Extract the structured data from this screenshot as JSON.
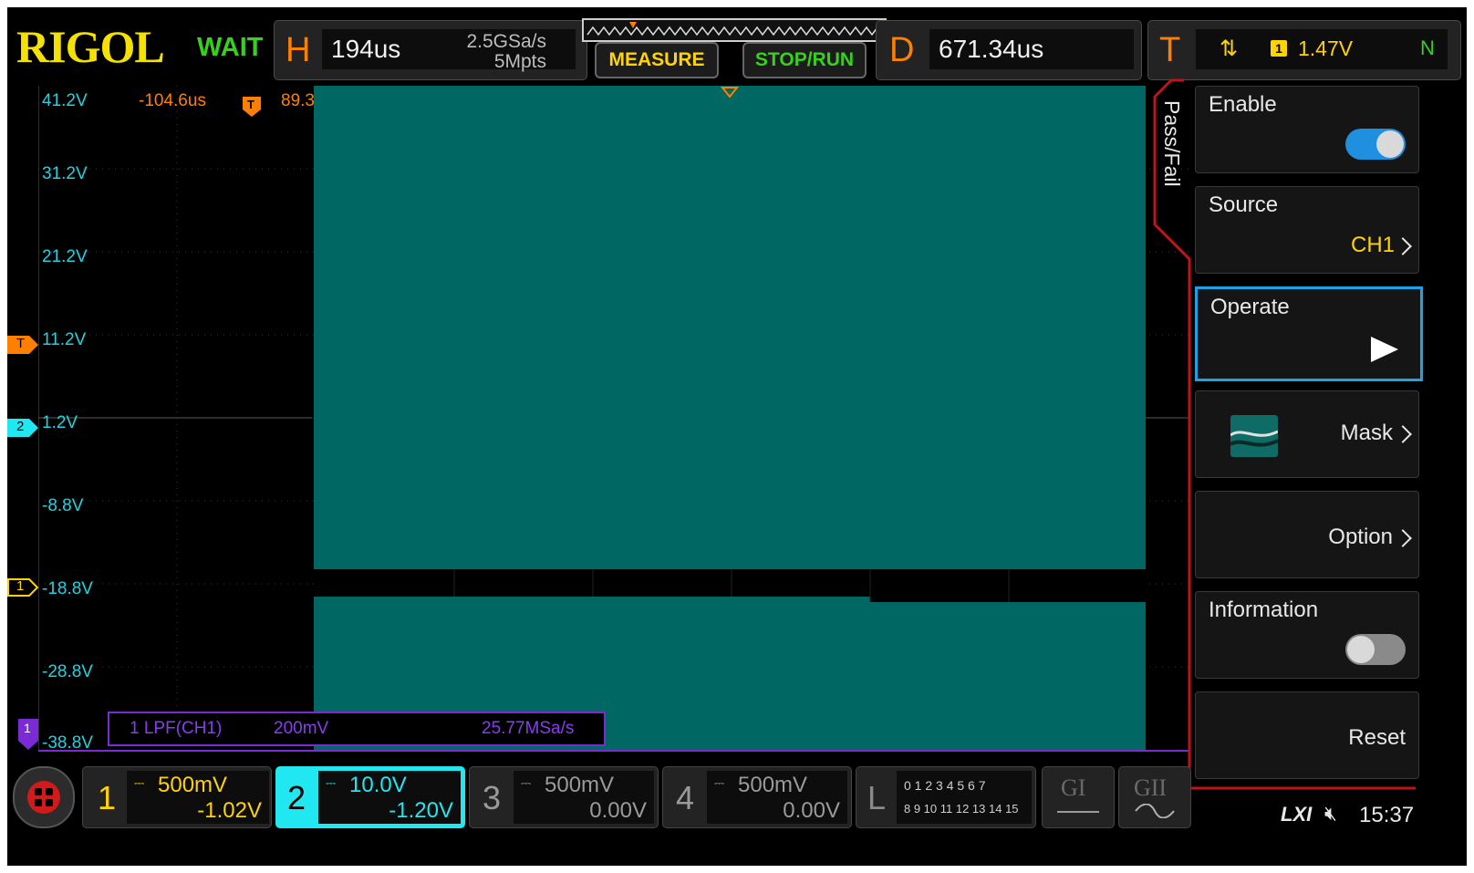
{
  "header": {
    "brand": "RIGOL",
    "status": "WAIT",
    "horizontal": {
      "letter": "H",
      "timebase": "194us",
      "sample_rate": "2.5GSa/s",
      "memory_depth": "5Mpts"
    },
    "buttons": {
      "measure": "MEASURE",
      "stop_run": "STOP/RUN"
    },
    "delay": {
      "letter": "D",
      "value": "671.34us"
    },
    "trigger": {
      "letter": "T",
      "channel": "1",
      "level": "1.47V",
      "mode": "N"
    }
  },
  "waveform": {
    "y_labels": [
      "41.2V",
      "31.2V",
      "21.2V",
      "11.2V",
      "1.2V",
      "-8.8V",
      "-18.8V",
      "-28.8V",
      "-38.8V"
    ],
    "cursor_a": "-104.6us",
    "cursor_b": "89.3",
    "trigger_marker": "T",
    "channel_markers": [
      "2",
      "1"
    ],
    "math_marker": "1",
    "waveform_color": "#006762",
    "math_info": {
      "label": "1  LPF(CH1)",
      "scale": "200mV",
      "rate": "25.77MSa/s"
    }
  },
  "menu": {
    "tab": "Pass/Fail",
    "items": {
      "enable": {
        "label": "Enable",
        "state": "on"
      },
      "source": {
        "label": "Source",
        "value": "CH1"
      },
      "operate": {
        "label": "Operate",
        "icon": "play-icon"
      },
      "mask": {
        "label": "Mask",
        "icon": "mask-icon"
      },
      "option": {
        "label": "Option"
      },
      "information": {
        "label": "Information",
        "state": "off"
      },
      "reset": {
        "label": "Reset"
      }
    }
  },
  "footer": {
    "channels": [
      {
        "num": "1",
        "scale": "500mV",
        "offset": "-1.02V",
        "color": "#ffd400"
      },
      {
        "num": "2",
        "scale": "10.0V",
        "offset": "-1.20V",
        "color": "#20e7f0"
      },
      {
        "num": "3",
        "scale": "500mV",
        "offset": "0.00V",
        "color": "#9a9a9a"
      },
      {
        "num": "4",
        "scale": "500mV",
        "offset": "0.00V",
        "color": "#9a9a9a"
      }
    ],
    "logic": {
      "letter": "L",
      "row1": "0 1 2 3  4 5 6 7",
      "row2": "8  9 10 11  12 13 14 15"
    },
    "gi": "GI",
    "gii": "GII",
    "lxi": "LXI",
    "time": "15:37"
  },
  "colors": {
    "accent_orange": "#ff8000",
    "cyan": "#1fd3e0",
    "yellow": "#ffd400",
    "purple": "#7b2bd6",
    "menu_border": "#c0141a",
    "selected": "#1aa3e6"
  }
}
